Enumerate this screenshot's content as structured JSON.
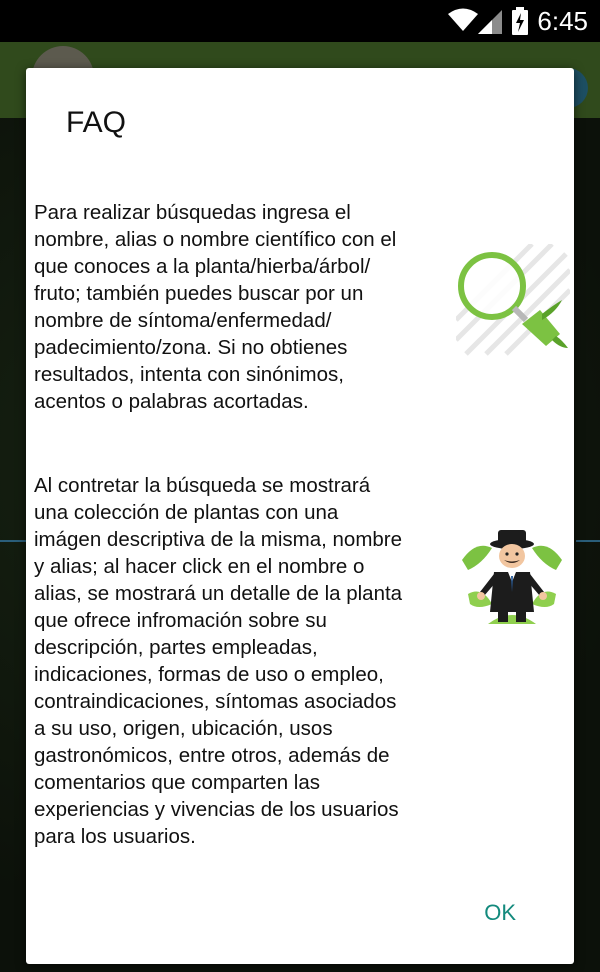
{
  "status_bar": {
    "time": "6:45",
    "icons": [
      "wifi-icon",
      "cellular-signal-icon",
      "battery-charging-icon"
    ]
  },
  "dialog": {
    "title": "FAQ",
    "paragraphs": [
      "Para realizar búsquedas ingresa el\nnombre, alias o nombre científico con el\nque conoces a la planta/hierba/árbol/\nfruto; también puedes buscar por un\nnombre de síntoma/enfermedad/\npadecimiento/zona. Si no obtienes\nresultados, intenta con sinónimos,\nacentos o palabras acortadas.",
      "Al contretar la búsqueda se mostrará\nuna colección de plantas con una\nimágen descriptiva de la misma, nombre\ny alias; al hacer click en el nombre o\nalias, se mostrará un detalle de la planta\nque ofrece infromación sobre su\ndescripción, partes empleadas,\nindicaciones, formas de uso o empleo,\ncontraindicaciones, síntomas asociados\na su uso, origen, ubicación, usos\ngastronómicos, entre otros, además de\ncomentarios que comparten las\nexperiencias y vivencias de los usuarios\npara los usuarios."
    ],
    "illustrations": [
      "magnifier-leaf-icon",
      "herbalist-man-icon"
    ],
    "ok_label": "OK"
  },
  "colors": {
    "accent": "#138a7d",
    "app_bar": "#304a1c",
    "illustration_green": "#7cc242"
  }
}
